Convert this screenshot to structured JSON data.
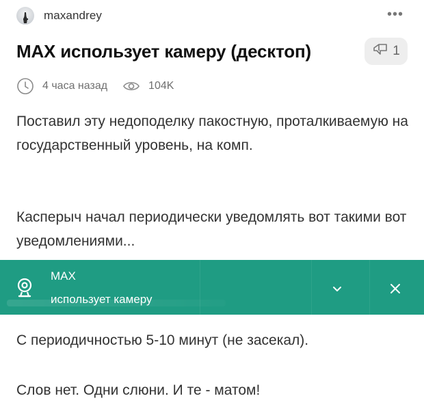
{
  "post": {
    "author": "maxandrey",
    "more_label": "•••",
    "title": "MAX использует камеру (десктоп)",
    "reply_count": "1",
    "time_ago": "4 часа назад",
    "views": "104K",
    "paragraphs": [
      "Поставил эту недоподелку пакостную, проталкиваемую на государственный уровень, на комп.",
      "Касперыч начал периодически уведомлять вот такими вот уведомлениями...",
      "С периодичностью 5-10 минут (не засекал).",
      "Слов нет. Одни слюни. И те - матом!"
    ]
  },
  "notification": {
    "app": "MAX",
    "message": "использует камеру",
    "accent": "#1f9c83"
  },
  "icons": {
    "avatar": "avatar",
    "more": "more-dots-icon",
    "reply": "reply-icon",
    "time": "clock-icon",
    "views": "eye-icon",
    "camera": "webcam-icon",
    "expand": "chevron-down-icon",
    "close": "close-icon"
  }
}
